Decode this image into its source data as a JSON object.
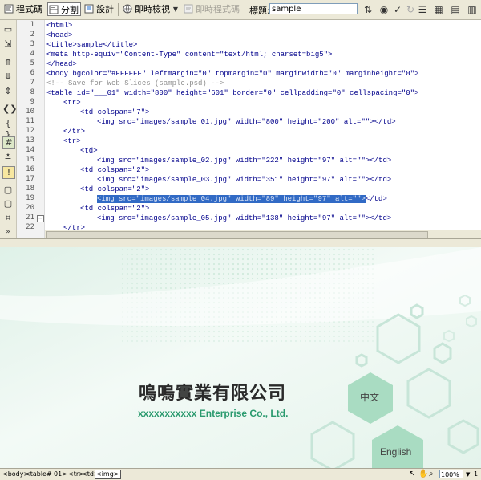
{
  "toolbar": {
    "code_label": "程式碼",
    "split_label": "分割",
    "design_label": "設計",
    "live_view_label": "即時檢視",
    "live_code_label": "即時程式碼",
    "title_label": "標題:",
    "title_value": "sample"
  },
  "code": {
    "line_numbers": [
      "1",
      "2",
      "3",
      "4",
      "5",
      "6",
      "7",
      "8",
      "9",
      "10",
      "11",
      "12",
      "13",
      "14",
      "15",
      "16",
      "17",
      "18",
      "19",
      "20",
      "21",
      "22"
    ],
    "lines": [
      {
        "text": "<html>",
        "cls": "tag",
        "indent": 0
      },
      {
        "text": "<head>",
        "cls": "tag",
        "indent": 0
      },
      {
        "text": "<title>sample</title>",
        "cls": "tag",
        "indent": 0
      },
      {
        "text": "<meta http-equiv=\"Content-Type\" content=\"text/html; charset=big5\">",
        "cls": "tag",
        "indent": 0
      },
      {
        "text": "</head>",
        "cls": "tag",
        "indent": 0
      },
      {
        "text": "<body bgcolor=\"#FFFFFF\" leftmargin=\"0\" topmargin=\"0\" marginwidth=\"0\" marginheight=\"0\">",
        "cls": "tag",
        "indent": 0
      },
      {
        "text": "<!-- Save for Web Slices (sample.psd) -->",
        "cls": "cmt",
        "indent": 0
      },
      {
        "text": "<table id=\"___01\" width=\"800\" height=\"601\" border=\"0\" cellpadding=\"0\" cellspacing=\"0\">",
        "cls": "tag",
        "indent": 0
      },
      {
        "text": "<tr>",
        "cls": "tag",
        "indent": 1
      },
      {
        "text": "<td colspan=\"7\">",
        "cls": "tag",
        "indent": 2
      },
      {
        "text": "<img src=\"images/sample_01.jpg\" width=\"800\" height=\"200\" alt=\"\"></td>",
        "cls": "tag",
        "indent": 3
      },
      {
        "text": "</tr>",
        "cls": "tag",
        "indent": 1
      },
      {
        "text": "<tr>",
        "cls": "tag",
        "indent": 1
      },
      {
        "text": "<td>",
        "cls": "tag",
        "indent": 2
      },
      {
        "text": "<img src=\"images/sample_02.jpg\" width=\"222\" height=\"97\" alt=\"\"></td>",
        "cls": "tag",
        "indent": 3
      },
      {
        "text": "<td colspan=\"2\">",
        "cls": "tag",
        "indent": 2
      },
      {
        "text": "<img src=\"images/sample_03.jpg\" width=\"351\" height=\"97\" alt=\"\"></td>",
        "cls": "tag",
        "indent": 3
      },
      {
        "text": "<td colspan=\"2\">",
        "cls": "tag",
        "indent": 2
      },
      {
        "text": "<img src=\"images/sample_04.jpg\" width=\"89\" height=\"97\" alt=\"\">",
        "tail": "</td>",
        "cls": "tag sel",
        "indent": 3
      },
      {
        "text": "<td colspan=\"2\">",
        "cls": "tag",
        "indent": 2
      },
      {
        "text": "<img src=\"images/sample_05.jpg\" width=\"138\" height=\"97\" alt=\"\"></td>",
        "cls": "tag",
        "indent": 3
      },
      {
        "text": "</tr>",
        "cls": "tag",
        "indent": 1
      }
    ]
  },
  "design": {
    "company_chinese": "嗚嗚實業有限公司",
    "company_english": "xxxxxxxxxxx Enterprise Co., Ltd.",
    "btn_chinese": "中文",
    "btn_english": "English"
  },
  "status": {
    "tags": [
      "<body>",
      "<table#",
      "01>",
      "<tr>",
      "<td>",
      "<img>"
    ],
    "zoom": "100%"
  },
  "colors": {
    "tag_text": "#00008b",
    "comment_text": "#8f8f8f",
    "selection": "#316ac5",
    "hex_outline": "#c7e5d8",
    "hex_fill": "#a9dcc2"
  }
}
